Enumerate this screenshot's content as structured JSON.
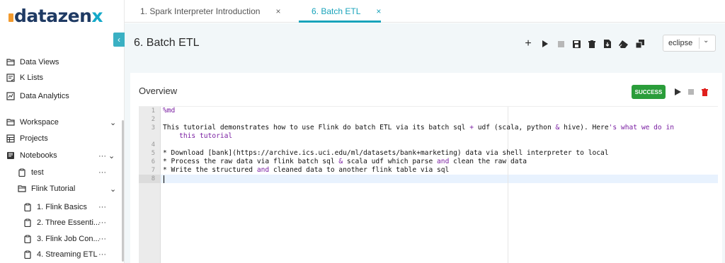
{
  "brand": {
    "logo_text_a": "atazen",
    "logo_text_x": "x"
  },
  "sidebar": {
    "collapse_icon": "chevron-left-icon",
    "items": [
      {
        "label": "Data Views",
        "icon": "folder-open-icon"
      },
      {
        "label": "K Lists",
        "icon": "list-check-icon"
      },
      {
        "label": "Data Analytics",
        "icon": "chart-icon"
      },
      {
        "label": "Workspace",
        "icon": "folder-open-icon",
        "right": "⌄"
      },
      {
        "label": "Projects",
        "icon": "table-icon"
      },
      {
        "label": "Notebooks",
        "icon": "book-icon",
        "right": "··· ⌄"
      },
      {
        "label": "test",
        "icon": "clipboard-icon",
        "right": "···"
      },
      {
        "label": "Flink Tutorial",
        "icon": "folder-open-icon",
        "right": "⌄"
      },
      {
        "label": "1. Flink Basics",
        "icon": "clipboard-icon",
        "right": "···"
      },
      {
        "label": "2. Three Essenti...",
        "icon": "clipboard-icon",
        "right": "···"
      },
      {
        "label": "3. Flink Job Con...",
        "icon": "clipboard-icon",
        "right": "···"
      },
      {
        "label": "4. Streaming ETL",
        "icon": "clipboard-icon",
        "right": "···"
      }
    ]
  },
  "tabs": [
    {
      "label": "1. Spark Interpreter Introduction",
      "close": "×",
      "active": false
    },
    {
      "label": "6. Batch ETL",
      "close": "×",
      "active": true
    }
  ],
  "header": {
    "title": "6. Batch ETL",
    "toolbar": [
      "plus-icon",
      "play-icon",
      "stop-icon",
      "save-icon",
      "trash-icon",
      "export-icon",
      "eraser-icon",
      "clone-icon"
    ],
    "theme_value": "eclipse",
    "theme_chevron": "⌄"
  },
  "paragraph": {
    "title": "Overview",
    "status": "SUCCESS",
    "status_color": "#2a9d3a",
    "delete_color": "#e0201d",
    "line_numbers": [
      "1",
      "2",
      "3",
      "",
      "4",
      "5",
      "6",
      "7",
      "8"
    ],
    "lines": [
      {
        "plain": "%md"
      },
      {
        "plain": ""
      },
      {
        "plain": "This tutorial demonstrates how to use Flink do batch ETL via its batch sql + udf (scala, python & hive). Here's what we do in"
      },
      {
        "plain": "    this tutorial"
      },
      {
        "plain": ""
      },
      {
        "plain": "* Download [bank](https://archive.ics.uci.edu/ml/datasets/bank+marketing) data via shell interpreter to local"
      },
      {
        "plain": "* Process the raw data via flink batch sql & scala udf which parse and clean the raw data"
      },
      {
        "plain": "* Write the structured and cleaned data to another flink table via sql"
      },
      {
        "plain": ""
      }
    ]
  },
  "colors": {
    "accent": "#19a3bb",
    "brand_dark": "#1f3a63",
    "brand_orange": "#f29a2e",
    "panel_bg": "#f2f7f9"
  }
}
